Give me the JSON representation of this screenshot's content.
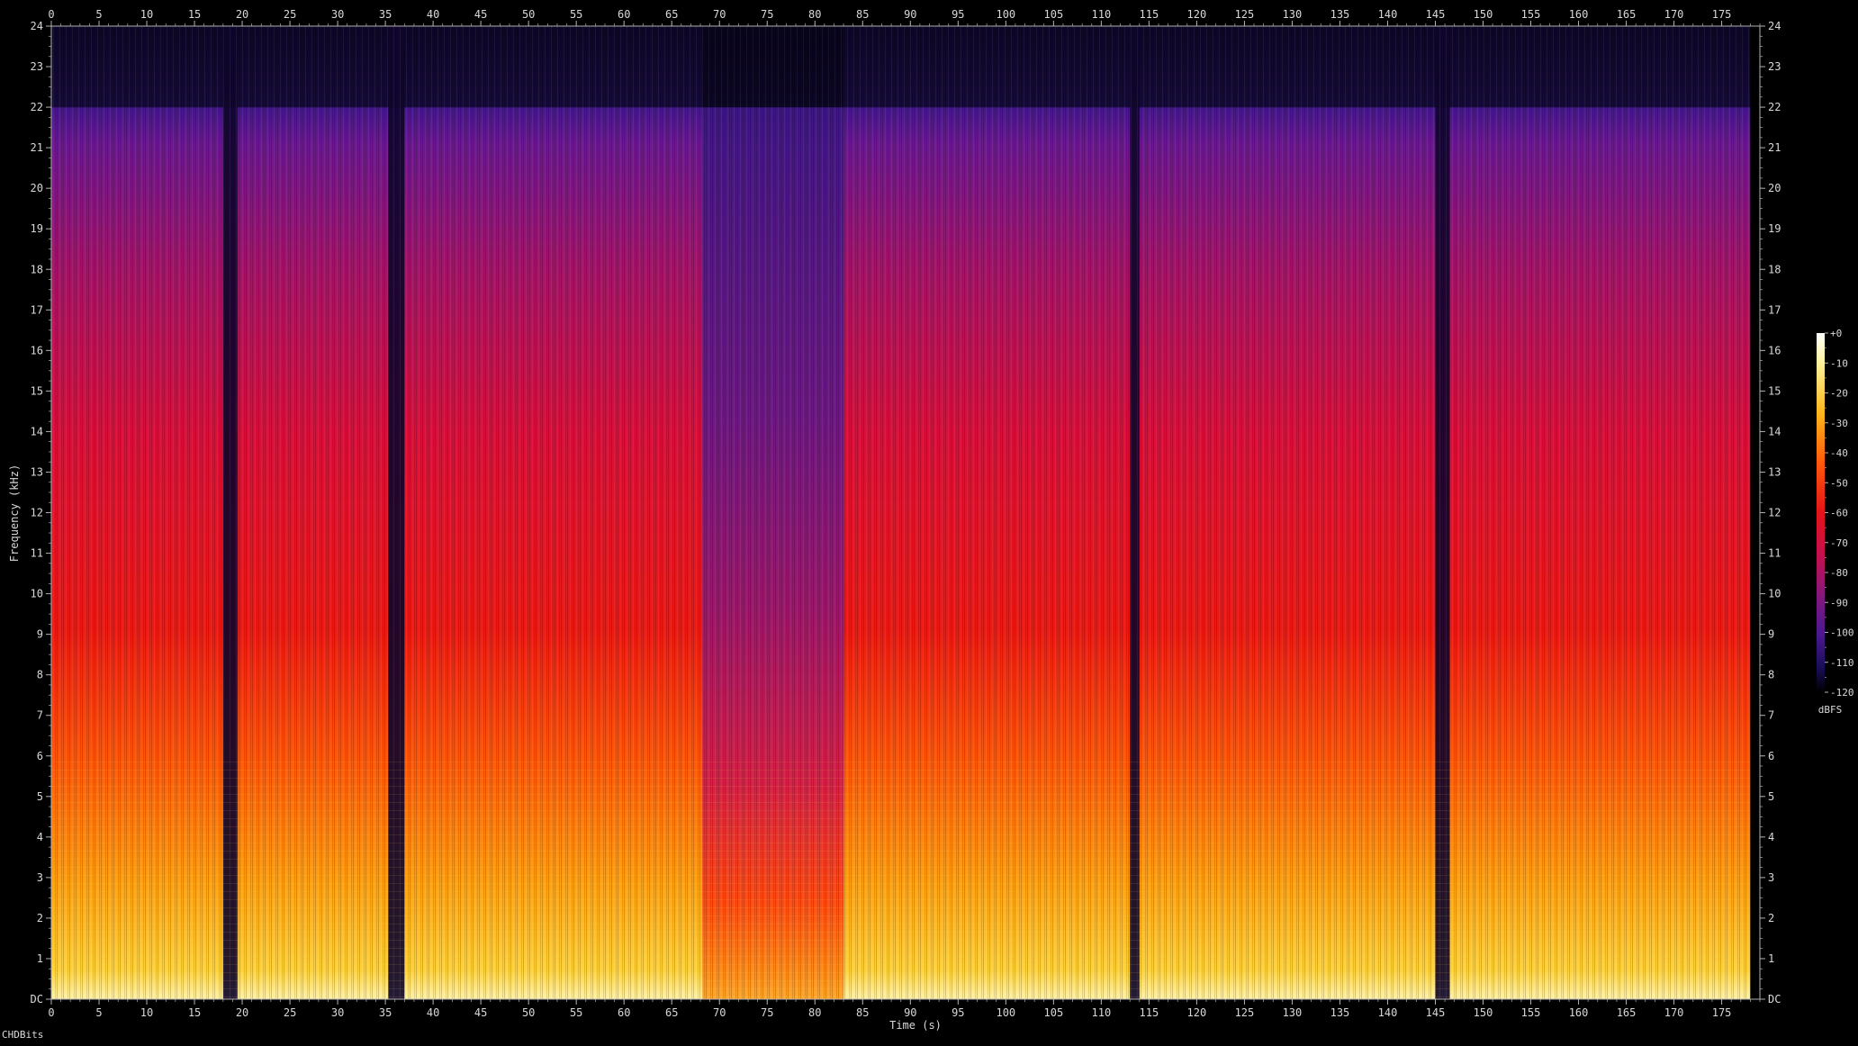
{
  "credit": "CHDBits",
  "chart_data": {
    "type": "heatmap",
    "title": "",
    "xlabel": "Time (s)",
    "ylabel": "Frequency (kHz)",
    "xlim": [
      0,
      179
    ],
    "ylim": [
      0,
      24
    ],
    "x_ticks": [
      "0",
      "5",
      "10",
      "15",
      "20",
      "25",
      "30",
      "35",
      "40",
      "45",
      "50",
      "55",
      "60",
      "65",
      "70",
      "75",
      "80",
      "85",
      "90",
      "95",
      "100",
      "105",
      "110",
      "115",
      "120",
      "125",
      "130",
      "135",
      "140",
      "145",
      "150",
      "155",
      "160",
      "165",
      "170",
      "175"
    ],
    "y_ticks": [
      "DC",
      "1",
      "2",
      "3",
      "4",
      "5",
      "6",
      "7",
      "8",
      "9",
      "10",
      "11",
      "12",
      "13",
      "14",
      "15",
      "16",
      "17",
      "18",
      "19",
      "20",
      "21",
      "22",
      "23",
      "24"
    ],
    "colorbar": {
      "label": "dBFS",
      "ticks": [
        "+0",
        "-10",
        "-20",
        "-30",
        "-40",
        "-50",
        "-60",
        "-70",
        "-80",
        "-90",
        "-100",
        "-110",
        "-120"
      ],
      "range": [
        -120,
        0
      ]
    },
    "lowpass_cutoff_khz": 22,
    "low_energy_segments_s": [
      [
        18,
        19.5
      ],
      [
        35.3,
        37
      ],
      [
        68.2,
        83
      ],
      [
        113,
        114
      ],
      [
        145,
        146.5
      ]
    ],
    "end_time_s": 178
  },
  "colors": {
    "background": "#000000",
    "axis": "#b0b0b0",
    "text": "#d8d8d8"
  }
}
